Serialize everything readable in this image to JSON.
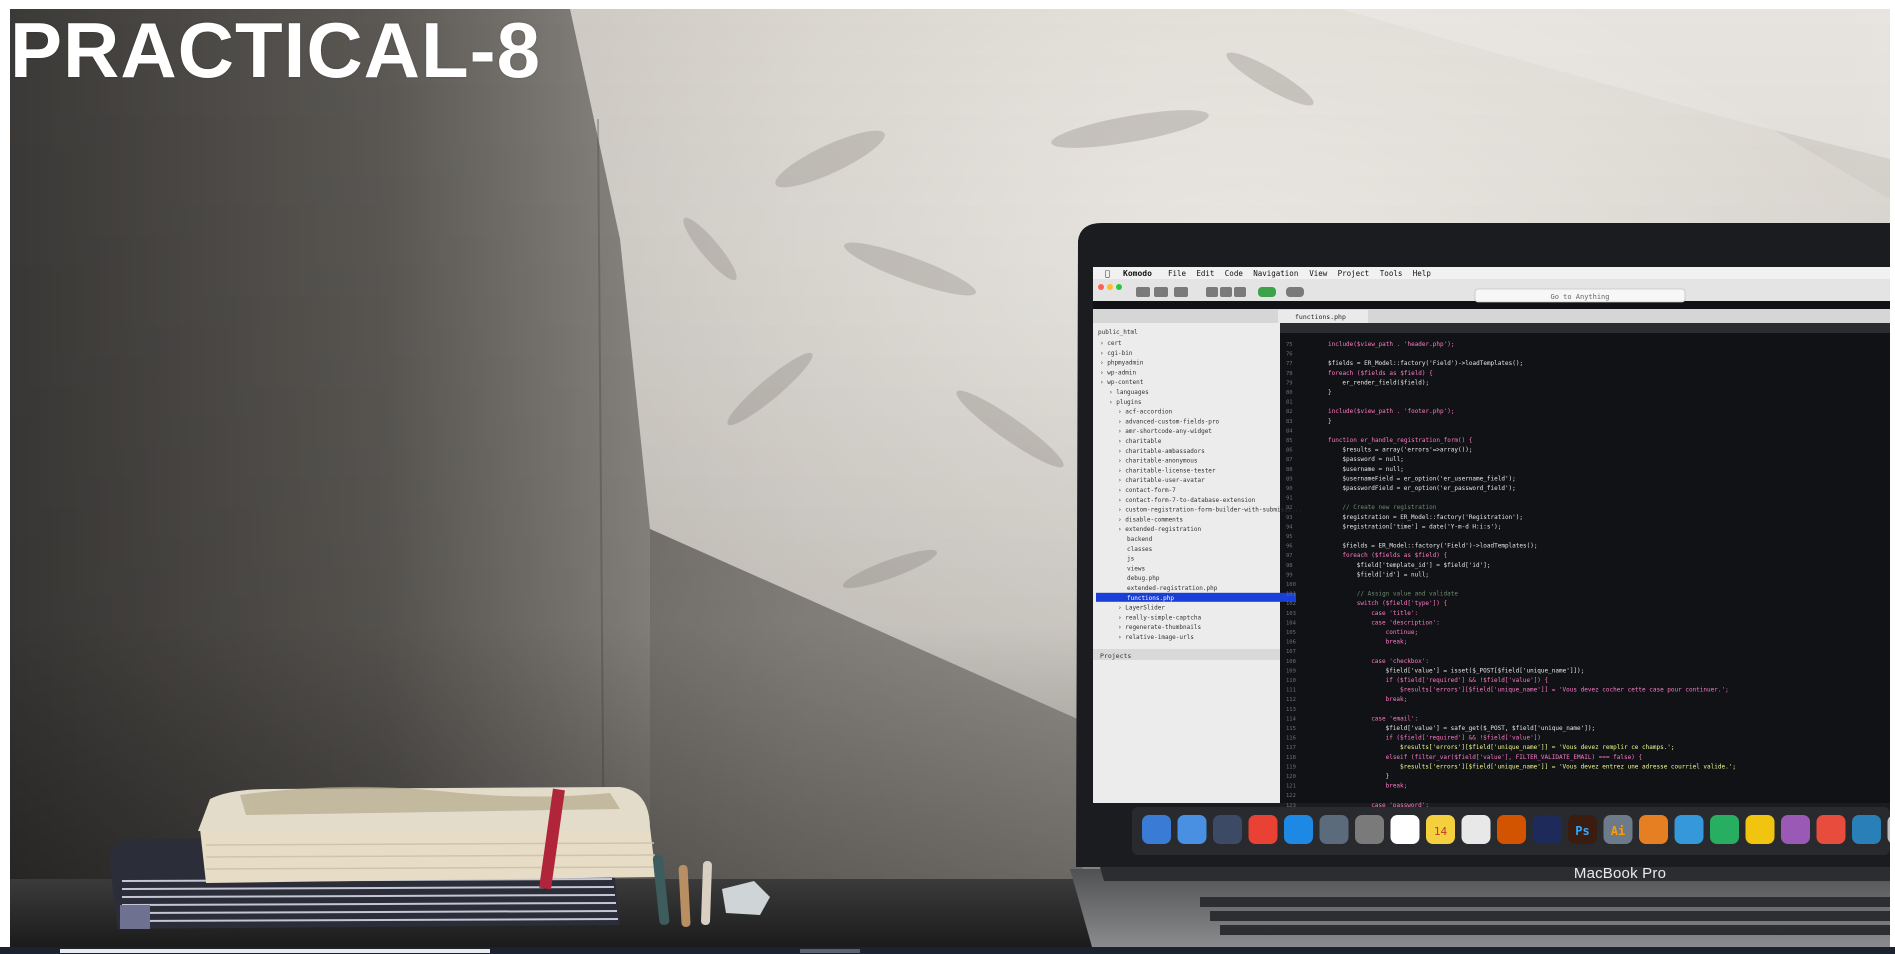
{
  "slide": {
    "title": "PRACTICAL-8",
    "laptop_brand": "MacBook Pro"
  },
  "screen": {
    "menubar": {
      "apple": "",
      "app": "Komodo",
      "items": [
        "File",
        "Edit",
        "Code",
        "Navigation",
        "View",
        "Project",
        "Tools",
        "Help"
      ]
    },
    "search_placeholder": "Go to Anything",
    "file_tab": "functions.php",
    "sidebar": {
      "root": "public_html",
      "items": [
        "cert",
        "cgi-bin",
        "phpmyadmin",
        "wp-admin",
        "wp-content",
        "languages",
        "plugins",
        "acf-accordion",
        "advanced-custom-fields-pro",
        "amr-shortcode-any-widget",
        "charitable",
        "charitable-ambassadors",
        "charitable-anonymous",
        "charitable-license-tester",
        "charitable-user-avatar",
        "contact-form-7",
        "contact-form-7-to-database-extension",
        "custom-registration-form-builder-with-submissi...",
        "disable-comments",
        "extended-registration",
        "backend",
        "classes",
        "js",
        "views",
        "debug.php",
        "extended-registration.php",
        "functions.php",
        "LayerSlider",
        "really-simple-captcha",
        "regenerate-thumbnails",
        "relative-image-urls"
      ],
      "projects_label": "Projects"
    },
    "code_lines": [
      "include($view_path . 'header.php');",
      "",
      "$fields = ER_Model::factory('Field')->loadTemplates();",
      "foreach ($fields as $field) {",
      "    er_render_field($field);",
      "}",
      "",
      "include($view_path . 'footer.php');",
      "}",
      "",
      "function er_handle_registration_form() {",
      "    $results = array('errors'=>array());",
      "    $password = null;",
      "    $username = null;",
      "    $usernameField = er_option('er_username_field');",
      "    $passwordField = er_option('er_password_field');",
      "",
      "    // Create new registration",
      "    $registration = ER_Model::factory('Registration');",
      "    $registration['time'] = date('Y-m-d H:i:s');",
      "",
      "    $fields = ER_Model::factory('Field')->loadTemplates();",
      "    foreach ($fields as $field) {",
      "        $field['template_id'] = $field['id'];",
      "        $field['id'] = null;",
      "",
      "        // Assign value and validate",
      "        switch ($field['type']) {",
      "            case 'title':",
      "            case 'description':",
      "                continue;",
      "                break;",
      "",
      "            case 'checkbox':",
      "                $field['value'] = isset($_POST[$field['unique_name']]);",
      "                if ($field['required'] && !$field['value']) {",
      "                    $results['errors'][$field['unique_name']] = 'Vous devez cocher cette case pour continuer.';",
      "                break;",
      "",
      "            case 'email':",
      "                $field['value'] = safe_get($_POST, $field['unique_name']);",
      "                if ($field['required'] && !$field['value'])",
      "                    $results['errors'][$field['unique_name']] = 'Vous devez remplir ce champs.';",
      "                elseif (filter_var($field['value'], FILTER_VALIDATE_EMAIL) === false) {",
      "                    $results['errors'][$field['unique_name']] = 'Vous devez entrez une adresse courriel valide.';",
      "                }",
      "                break;",
      "",
      "            case 'password':"
    ],
    "line_start": 75,
    "dock_date": "14",
    "dock_labels": [
      "Ps",
      "Ai"
    ]
  },
  "palette": {
    "wall": "#b9b5af",
    "light_patch": "#efece7",
    "desk": "#2a2a2a",
    "code_bg": "#101216",
    "selection": "#1a3fd8",
    "book_band": "#b0253a"
  }
}
